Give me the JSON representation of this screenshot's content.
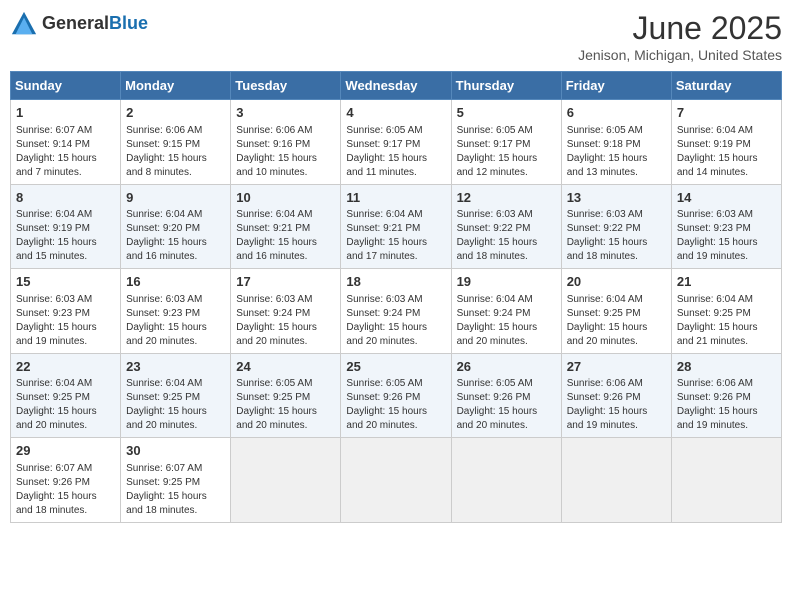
{
  "header": {
    "logo": {
      "text_general": "General",
      "text_blue": "Blue"
    },
    "title": "June 2025",
    "subtitle": "Jenison, Michigan, United States"
  },
  "calendar": {
    "days_of_week": [
      "Sunday",
      "Monday",
      "Tuesday",
      "Wednesday",
      "Thursday",
      "Friday",
      "Saturday"
    ],
    "weeks": [
      [
        {
          "day": "1",
          "info": "Sunrise: 6:07 AM\nSunset: 9:14 PM\nDaylight: 15 hours\nand 7 minutes."
        },
        {
          "day": "2",
          "info": "Sunrise: 6:06 AM\nSunset: 9:15 PM\nDaylight: 15 hours\nand 8 minutes."
        },
        {
          "day": "3",
          "info": "Sunrise: 6:06 AM\nSunset: 9:16 PM\nDaylight: 15 hours\nand 10 minutes."
        },
        {
          "day": "4",
          "info": "Sunrise: 6:05 AM\nSunset: 9:17 PM\nDaylight: 15 hours\nand 11 minutes."
        },
        {
          "day": "5",
          "info": "Sunrise: 6:05 AM\nSunset: 9:17 PM\nDaylight: 15 hours\nand 12 minutes."
        },
        {
          "day": "6",
          "info": "Sunrise: 6:05 AM\nSunset: 9:18 PM\nDaylight: 15 hours\nand 13 minutes."
        },
        {
          "day": "7",
          "info": "Sunrise: 6:04 AM\nSunset: 9:19 PM\nDaylight: 15 hours\nand 14 minutes."
        }
      ],
      [
        {
          "day": "8",
          "info": "Sunrise: 6:04 AM\nSunset: 9:19 PM\nDaylight: 15 hours\nand 15 minutes."
        },
        {
          "day": "9",
          "info": "Sunrise: 6:04 AM\nSunset: 9:20 PM\nDaylight: 15 hours\nand 16 minutes."
        },
        {
          "day": "10",
          "info": "Sunrise: 6:04 AM\nSunset: 9:21 PM\nDaylight: 15 hours\nand 16 minutes."
        },
        {
          "day": "11",
          "info": "Sunrise: 6:04 AM\nSunset: 9:21 PM\nDaylight: 15 hours\nand 17 minutes."
        },
        {
          "day": "12",
          "info": "Sunrise: 6:03 AM\nSunset: 9:22 PM\nDaylight: 15 hours\nand 18 minutes."
        },
        {
          "day": "13",
          "info": "Sunrise: 6:03 AM\nSunset: 9:22 PM\nDaylight: 15 hours\nand 18 minutes."
        },
        {
          "day": "14",
          "info": "Sunrise: 6:03 AM\nSunset: 9:23 PM\nDaylight: 15 hours\nand 19 minutes."
        }
      ],
      [
        {
          "day": "15",
          "info": "Sunrise: 6:03 AM\nSunset: 9:23 PM\nDaylight: 15 hours\nand 19 minutes."
        },
        {
          "day": "16",
          "info": "Sunrise: 6:03 AM\nSunset: 9:23 PM\nDaylight: 15 hours\nand 20 minutes."
        },
        {
          "day": "17",
          "info": "Sunrise: 6:03 AM\nSunset: 9:24 PM\nDaylight: 15 hours\nand 20 minutes."
        },
        {
          "day": "18",
          "info": "Sunrise: 6:03 AM\nSunset: 9:24 PM\nDaylight: 15 hours\nand 20 minutes."
        },
        {
          "day": "19",
          "info": "Sunrise: 6:04 AM\nSunset: 9:24 PM\nDaylight: 15 hours\nand 20 minutes."
        },
        {
          "day": "20",
          "info": "Sunrise: 6:04 AM\nSunset: 9:25 PM\nDaylight: 15 hours\nand 20 minutes."
        },
        {
          "day": "21",
          "info": "Sunrise: 6:04 AM\nSunset: 9:25 PM\nDaylight: 15 hours\nand 21 minutes."
        }
      ],
      [
        {
          "day": "22",
          "info": "Sunrise: 6:04 AM\nSunset: 9:25 PM\nDaylight: 15 hours\nand 20 minutes."
        },
        {
          "day": "23",
          "info": "Sunrise: 6:04 AM\nSunset: 9:25 PM\nDaylight: 15 hours\nand 20 minutes."
        },
        {
          "day": "24",
          "info": "Sunrise: 6:05 AM\nSunset: 9:25 PM\nDaylight: 15 hours\nand 20 minutes."
        },
        {
          "day": "25",
          "info": "Sunrise: 6:05 AM\nSunset: 9:26 PM\nDaylight: 15 hours\nand 20 minutes."
        },
        {
          "day": "26",
          "info": "Sunrise: 6:05 AM\nSunset: 9:26 PM\nDaylight: 15 hours\nand 20 minutes."
        },
        {
          "day": "27",
          "info": "Sunrise: 6:06 AM\nSunset: 9:26 PM\nDaylight: 15 hours\nand 19 minutes."
        },
        {
          "day": "28",
          "info": "Sunrise: 6:06 AM\nSunset: 9:26 PM\nDaylight: 15 hours\nand 19 minutes."
        }
      ],
      [
        {
          "day": "29",
          "info": "Sunrise: 6:07 AM\nSunset: 9:26 PM\nDaylight: 15 hours\nand 18 minutes."
        },
        {
          "day": "30",
          "info": "Sunrise: 6:07 AM\nSunset: 9:25 PM\nDaylight: 15 hours\nand 18 minutes."
        },
        {
          "day": "",
          "info": ""
        },
        {
          "day": "",
          "info": ""
        },
        {
          "day": "",
          "info": ""
        },
        {
          "day": "",
          "info": ""
        },
        {
          "day": "",
          "info": ""
        }
      ]
    ]
  }
}
